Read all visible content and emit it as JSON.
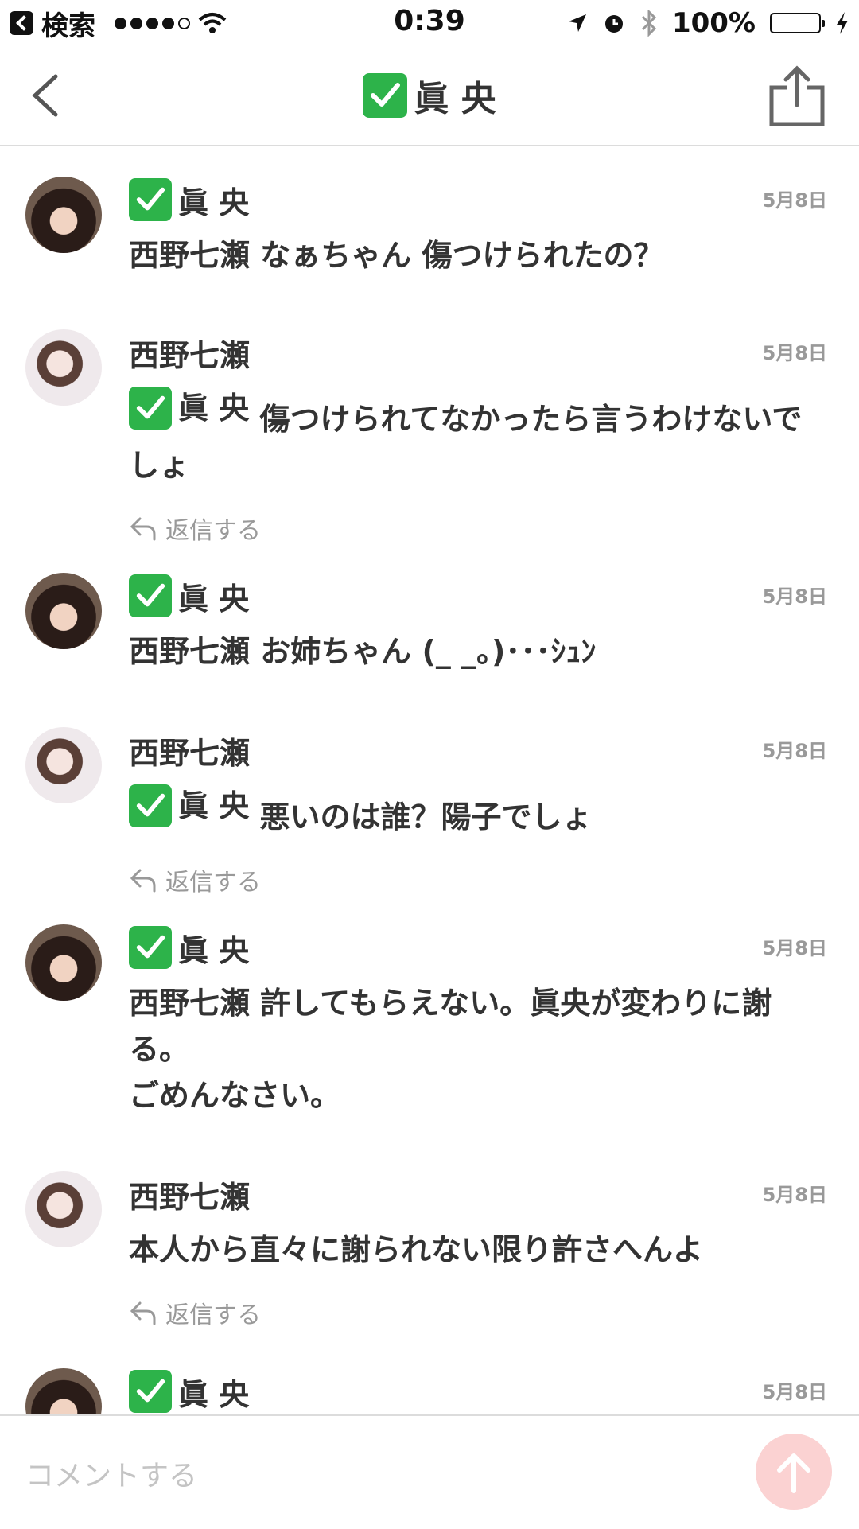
{
  "status_bar": {
    "back_label": "検索",
    "time": "0:39",
    "battery": "100%",
    "battery_level": 1.0,
    "signal_bars": 4
  },
  "nav": {
    "title_name": "眞 央",
    "title_badge": "check-mark-emoji",
    "back_icon": "chevron-left-icon",
    "share_icon": "share-icon"
  },
  "comments": [
    {
      "author": "眞 央",
      "author_badge": true,
      "avatar": "mao",
      "date": "5月8日",
      "mention": "",
      "mention_badge": false,
      "text": "西野七瀬 なぁちゃん 傷つけられたの？",
      "reply": ""
    },
    {
      "author": "西野七瀬",
      "author_badge": false,
      "avatar": "nanase",
      "date": "5月8日",
      "mention": "眞 央",
      "mention_badge": true,
      "text": "傷つけられてなかったら言うわけないでしょ",
      "reply": "返信する"
    },
    {
      "author": "眞 央",
      "author_badge": true,
      "avatar": "mao",
      "date": "5月8日",
      "mention": "",
      "mention_badge": false,
      "text": "西野七瀬 お姉ちゃん (_ _。)･･･ｼｭﾝ",
      "reply": ""
    },
    {
      "author": "西野七瀬",
      "author_badge": false,
      "avatar": "nanase",
      "date": "5月8日",
      "mention": "眞 央",
      "mention_badge": true,
      "text": "悪いのは誰？陽子でしょ",
      "reply": "返信する"
    },
    {
      "author": "眞 央",
      "author_badge": true,
      "avatar": "mao",
      "date": "5月8日",
      "mention": "",
      "mention_badge": false,
      "text": "西野七瀬 許してもらえない。眞央が変わりに謝る。\nごめんなさい。",
      "reply": ""
    },
    {
      "author": "西野七瀬",
      "author_badge": false,
      "avatar": "nanase",
      "date": "5月8日",
      "mention": "",
      "mention_badge": false,
      "text": "本人から直々に謝られない限り許さへんよ",
      "reply": "返信する"
    },
    {
      "author": "眞 央",
      "author_badge": true,
      "avatar": "mao",
      "date": "5月8日",
      "mention": "",
      "mention_badge": false,
      "text": "",
      "reply": ""
    }
  ],
  "input": {
    "placeholder": "コメントする",
    "send_icon": "arrow-up-icon",
    "send_color": "#fbd2d2"
  },
  "colors": {
    "badge_green": "#2db34a",
    "text": "#333333",
    "muted": "#999999",
    "divider": "#dcdcdc"
  }
}
